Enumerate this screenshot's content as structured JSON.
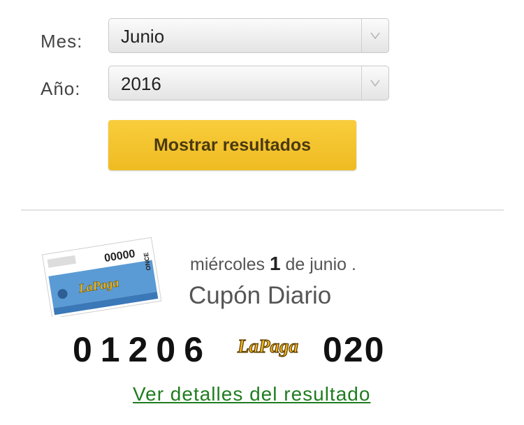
{
  "form": {
    "month_label": "Mes:",
    "month_value": "Junio",
    "year_label": "Año:",
    "year_value": "2016",
    "submit_label": "Mostrar resultados"
  },
  "result": {
    "weekday": "miércoles",
    "day": "1",
    "month_text": "de junio .",
    "draw_name": "Cupón Diario",
    "number": "01206",
    "series": "020",
    "details_link": "Ver detalles del resultado",
    "ticket_logo_text": "LaPaga",
    "logo_text": "LaPaga",
    "ticket_brand": "ONCE",
    "ticket_number": "00000"
  },
  "colors": {
    "button": "#f2c12e",
    "link": "#1f7d1f",
    "ticket_blue": "#5b9bd5"
  }
}
